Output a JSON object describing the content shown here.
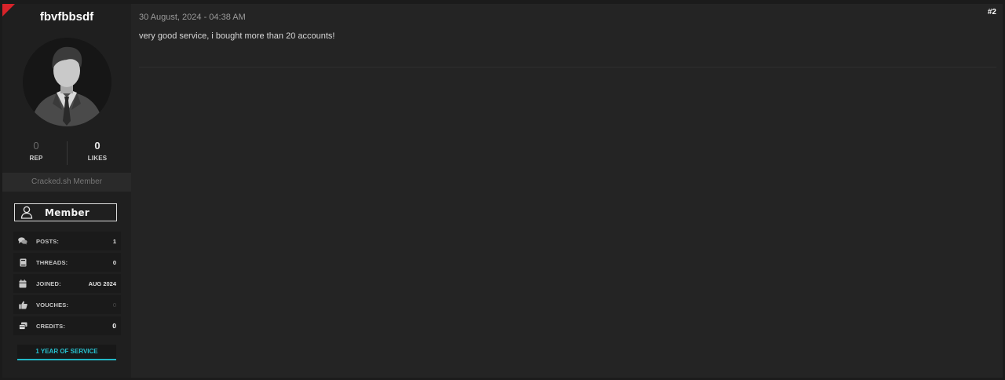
{
  "user": {
    "username": "fbvfbbsdf",
    "avatar_icon": "default-avatar-icon",
    "stats": {
      "rep_value": "0",
      "rep_label": "REP",
      "likes_value": "0",
      "likes_label": "LIKES"
    },
    "usertitle": "Cracked.sh Member",
    "rank": {
      "label": "Member",
      "icon": "user-icon"
    },
    "info": [
      {
        "icon": "comments-icon",
        "label": "POSTS:",
        "value": "1"
      },
      {
        "icon": "book-icon",
        "label": "THREADS:",
        "value": "0"
      },
      {
        "icon": "calendar-icon",
        "label": "JOINED:",
        "value": "AUG 2024"
      },
      {
        "icon": "thumbs-up-icon",
        "label": "VOUCHES:",
        "value": "0"
      },
      {
        "icon": "credits-icon",
        "label": "CREDITS:",
        "value": "0"
      }
    ],
    "service_badge": "1 YEAR OF SERVICE"
  },
  "post": {
    "date": "30 August, 2024 - 04:38 AM",
    "number": "#2",
    "message": "very good service, i bought more than 20 accounts!"
  },
  "colors": {
    "corner": "#d8232a",
    "service_accent": "#22b7c7"
  }
}
